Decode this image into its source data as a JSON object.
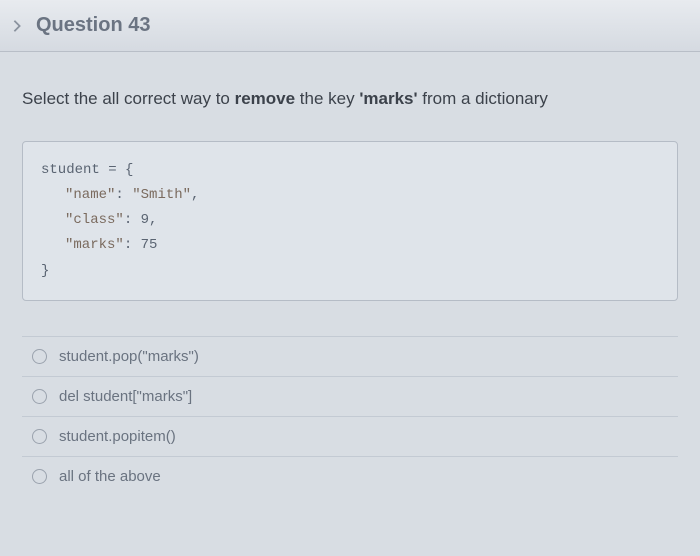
{
  "header": {
    "title": "Question 43"
  },
  "prompt": {
    "prefix": "Select the all correct way to ",
    "bold1": "remove",
    "mid": " the key ",
    "bold2": "'marks'",
    "suffix": " from a dictionary"
  },
  "code": {
    "line1": "student = {",
    "line2a": "\"name\"",
    "line2b": ": ",
    "line2c": "\"Smith\"",
    "line2d": ",",
    "line3a": "\"class\"",
    "line3b": ": ",
    "line3c": "9",
    "line3d": ",",
    "line4a": "\"marks\"",
    "line4b": ": ",
    "line4c": "75",
    "line5": "}"
  },
  "options": [
    {
      "label": "student.pop(\"marks\")"
    },
    {
      "label": "del student[\"marks\"]"
    },
    {
      "label": "student.popitem()"
    },
    {
      "label": "all of the above"
    }
  ]
}
